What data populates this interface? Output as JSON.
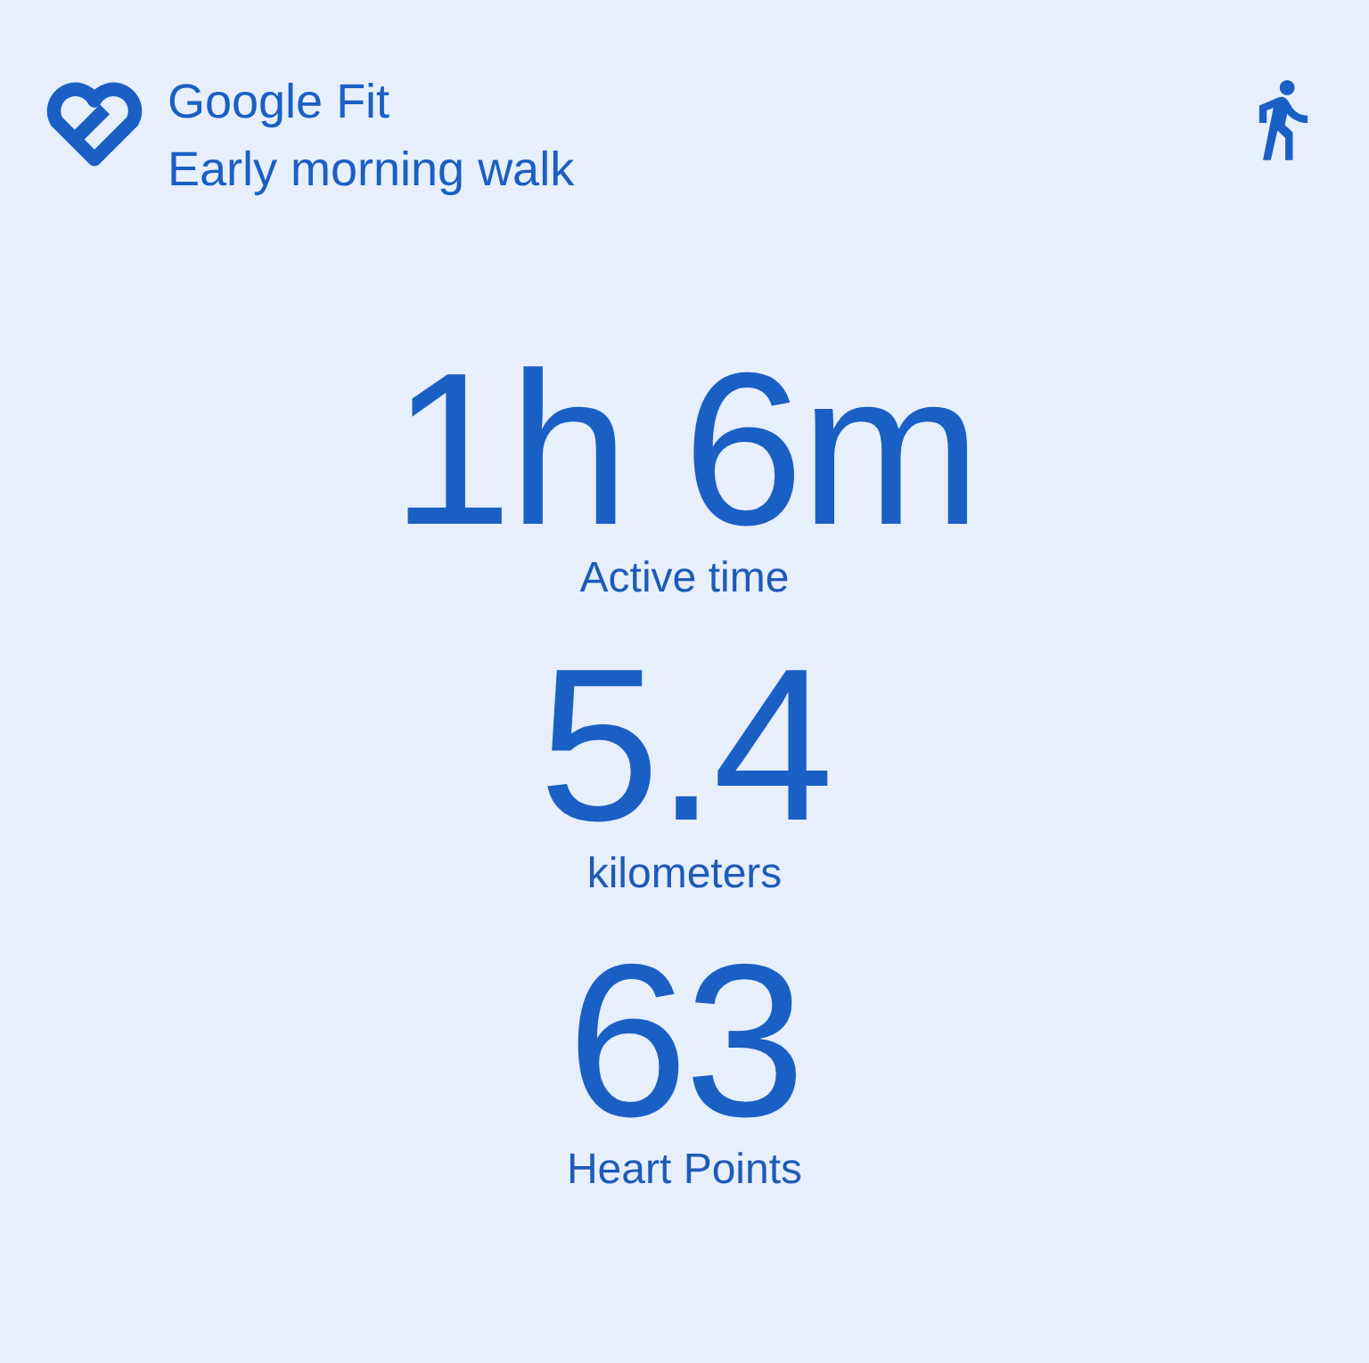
{
  "header": {
    "app_name": "Google Fit",
    "activity_title": "Early morning walk"
  },
  "stats": [
    {
      "value": "1h 6m",
      "label": "Active time"
    },
    {
      "value": "5.4",
      "label": "kilometers"
    },
    {
      "value": "63",
      "label": "Heart Points"
    }
  ]
}
